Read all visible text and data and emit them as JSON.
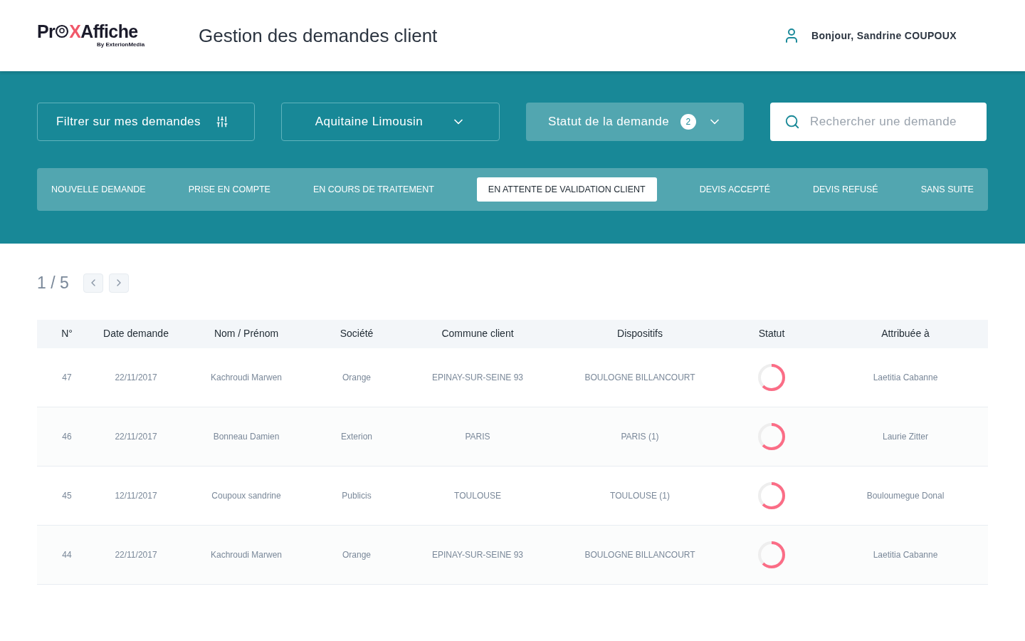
{
  "header": {
    "logo": {
      "before": "Pr",
      "mark": "X",
      "after": "Affiche",
      "tagline": "By ExterionMedia"
    },
    "title": "Gestion des demandes client",
    "greeting": "Bonjour, Sandrine COUPOUX"
  },
  "filters": {
    "my_requests": "Filtrer sur mes demandes",
    "region": "Aquitaine Limousin",
    "status": {
      "label": "Statut de la demande",
      "count": "2"
    },
    "search": {
      "placeholder": "Rechercher une demande"
    }
  },
  "tabs": [
    {
      "label": "NOUVELLE DEMANDE",
      "selected": false
    },
    {
      "label": "PRISE EN COMPTE",
      "selected": false
    },
    {
      "label": "EN COURS DE TRAITEMENT",
      "selected": false
    },
    {
      "label": "EN ATTENTE DE VALIDATION CLIENT",
      "selected": true
    },
    {
      "label": "DEVIS ACCEPTÉ",
      "selected": false
    },
    {
      "label": "DEVIS REFUSÉ",
      "selected": false
    },
    {
      "label": "SANS SUITE",
      "selected": false
    }
  ],
  "pagination": "1 / 5",
  "table": {
    "columns": [
      "N°",
      "Date demande",
      "Nom / Prénom",
      "Société",
      "Commune client",
      "Dispositifs",
      "Statut",
      "Attribuée à"
    ],
    "rows": [
      {
        "number": "47",
        "date": "22/11/2017",
        "name": "Kachroudi Marwen",
        "company": "Orange",
        "town": "EPINAY-SUR-SEINE 93",
        "devices": "BOULOGNE BILLANCOURT",
        "level": 0.62,
        "assignee": "Laetitia Cabanne"
      },
      {
        "number": "46",
        "date": "22/11/2017",
        "name": "Bonneau Damien",
        "company": "Exterion",
        "town": "PARIS",
        "devices": "PARIS (1)",
        "level": 0.62,
        "assignee": "Laurie Zitter"
      },
      {
        "number": "45",
        "date": "12/11/2017",
        "name": "Coupoux sandrine",
        "company": "Publicis",
        "town": "TOULOUSE",
        "devices": "TOULOUSE (1)",
        "level": 0.62,
        "assignee": "Bouloumegue Donal"
      },
      {
        "number": "44",
        "date": "22/11/2017",
        "name": "Kachroudi Marwen",
        "company": "Orange",
        "town": "EPINAY-SUR-SEINE 93",
        "devices": "BOULOGNE BILLANCOURT",
        "level": 0.62,
        "assignee": "Laetitia Cabanne"
      }
    ]
  }
}
